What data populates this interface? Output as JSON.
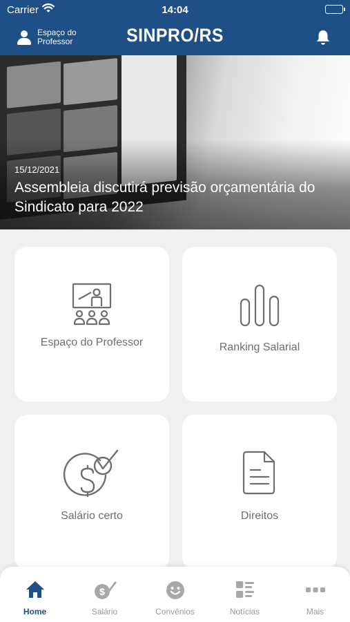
{
  "status_bar": {
    "carrier": "Carrier",
    "time": "14:04"
  },
  "header": {
    "profile_label": "Espaço do Professor",
    "logo": "SINPRO/RS"
  },
  "hero": {
    "date": "15/12/2021",
    "title": "Assembleia discutirá previsão orçamentária do Sindicato para 2022"
  },
  "cards": [
    {
      "label": "Espaço do Professor",
      "icon": "teacher-board-icon"
    },
    {
      "label": "Ranking Salarial",
      "icon": "bar-chart-icon"
    },
    {
      "label": "Salário certo",
      "icon": "dollar-check-icon"
    },
    {
      "label": "Direitos",
      "icon": "document-icon"
    }
  ],
  "tabs": [
    {
      "label": "Home",
      "icon": "home-icon",
      "active": true
    },
    {
      "label": "Salário",
      "icon": "dollar-check-icon"
    },
    {
      "label": "Convênios",
      "icon": "smiley-icon"
    },
    {
      "label": "Notícias",
      "icon": "news-icon"
    },
    {
      "label": "Mais",
      "icon": "more-icon"
    }
  ],
  "colors": {
    "primary": "#1e4f86",
    "background": "#f0f0f0",
    "icon_gray": "#6e6e6e",
    "tab_gray": "#9a9a9a"
  }
}
